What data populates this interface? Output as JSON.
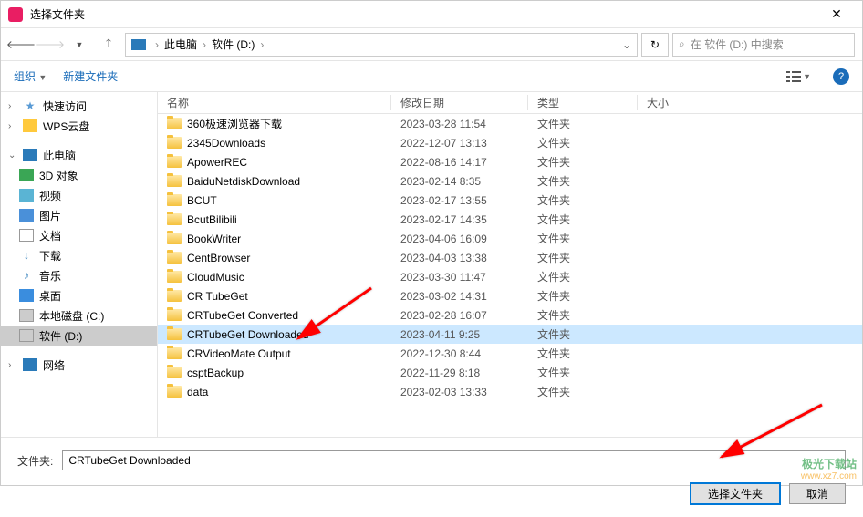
{
  "window": {
    "title": "选择文件夹",
    "close": "✕"
  },
  "nav": {
    "breadcrumb": {
      "root": "此电脑",
      "drive": "软件 (D:)"
    },
    "search_placeholder": "在 软件 (D:) 中搜索"
  },
  "toolbar": {
    "organize": "组织",
    "new_folder": "新建文件夹",
    "help": "?"
  },
  "sidebar": {
    "quick": "快速访问",
    "wps": "WPS云盘",
    "pc": "此电脑",
    "items": [
      {
        "label": "3D 对象"
      },
      {
        "label": "视频"
      },
      {
        "label": "图片"
      },
      {
        "label": "文档"
      },
      {
        "label": "下载"
      },
      {
        "label": "音乐"
      },
      {
        "label": "桌面"
      },
      {
        "label": "本地磁盘 (C:)"
      },
      {
        "label": "软件 (D:)"
      }
    ],
    "network": "网络"
  },
  "columns": {
    "name": "名称",
    "date": "修改日期",
    "type": "类型",
    "size": "大小"
  },
  "type_folder": "文件夹",
  "files": [
    {
      "name": "360极速浏览器下载",
      "date": "2023-03-28 11:54"
    },
    {
      "name": "2345Downloads",
      "date": "2022-12-07 13:13"
    },
    {
      "name": "ApowerREC",
      "date": "2022-08-16 14:17"
    },
    {
      "name": "BaiduNetdiskDownload",
      "date": "2023-02-14 8:35"
    },
    {
      "name": "BCUT",
      "date": "2023-02-17 13:55"
    },
    {
      "name": "BcutBilibili",
      "date": "2023-02-17 14:35"
    },
    {
      "name": "BookWriter",
      "date": "2023-04-06 16:09"
    },
    {
      "name": "CentBrowser",
      "date": "2023-04-03 13:38"
    },
    {
      "name": "CloudMusic",
      "date": "2023-03-30 11:47"
    },
    {
      "name": "CR TubeGet",
      "date": "2023-03-02 14:31"
    },
    {
      "name": "CRTubeGet Converted",
      "date": "2023-02-28 16:07"
    },
    {
      "name": "CRTubeGet Downloaded",
      "date": "2023-04-11 9:25",
      "selected": true
    },
    {
      "name": "CRVideoMate Output",
      "date": "2022-12-30 8:44"
    },
    {
      "name": "csptBackup",
      "date": "2022-11-29 8:18"
    },
    {
      "name": "data",
      "date": "2023-02-03 13:33"
    }
  ],
  "bottom": {
    "label": "文件夹:",
    "value": "CRTubeGet Downloaded",
    "select": "选择文件夹",
    "cancel": "取消"
  },
  "watermark": {
    "line1": "极光下载站",
    "line2": "www.xz7.com"
  }
}
